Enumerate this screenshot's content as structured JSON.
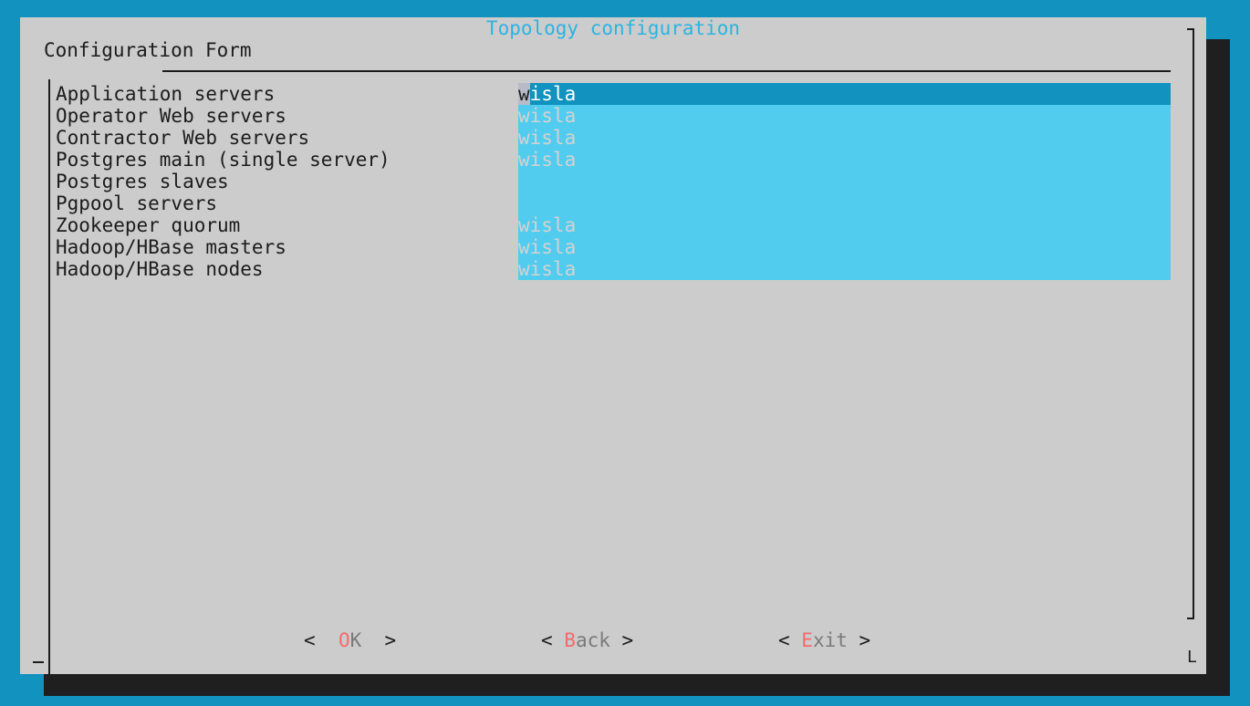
{
  "dialog": {
    "title": "Topology configuration",
    "form_label": "Configuration Form"
  },
  "fields": [
    {
      "label": "Application servers",
      "value": "wisla",
      "active": true
    },
    {
      "label": "Operator Web servers",
      "value": "wisla"
    },
    {
      "label": "Contractor Web servers",
      "value": "wisla"
    },
    {
      "label": "Postgres main (single server)",
      "value": "wisla"
    },
    {
      "label": "Postgres slaves",
      "value": ""
    },
    {
      "label": "Pgpool servers",
      "value": ""
    },
    {
      "label": "Zookeeper quorum",
      "value": "wisla"
    },
    {
      "label": "Hadoop/HBase masters",
      "value": "wisla"
    },
    {
      "label": "Hadoop/HBase nodes",
      "value": "wisla"
    }
  ],
  "active_field": {
    "cursor_char": "w",
    "rest": "isla"
  },
  "buttons": {
    "ok": {
      "open": "<  ",
      "hot": "O",
      "rest": "K",
      "close": "  >"
    },
    "back": {
      "open": "< ",
      "hot": "B",
      "rest": "ack",
      "close": " >"
    },
    "exit": {
      "open": "< ",
      "hot": "E",
      "rest": "xit",
      "close": " >"
    }
  },
  "colors": {
    "background": "#1192bf",
    "dialog": "#cccccc",
    "input_fill": "#51ccef",
    "active_input": "#1192bf",
    "hotkey": "#f26b6b",
    "title": "#2bb4e0"
  }
}
